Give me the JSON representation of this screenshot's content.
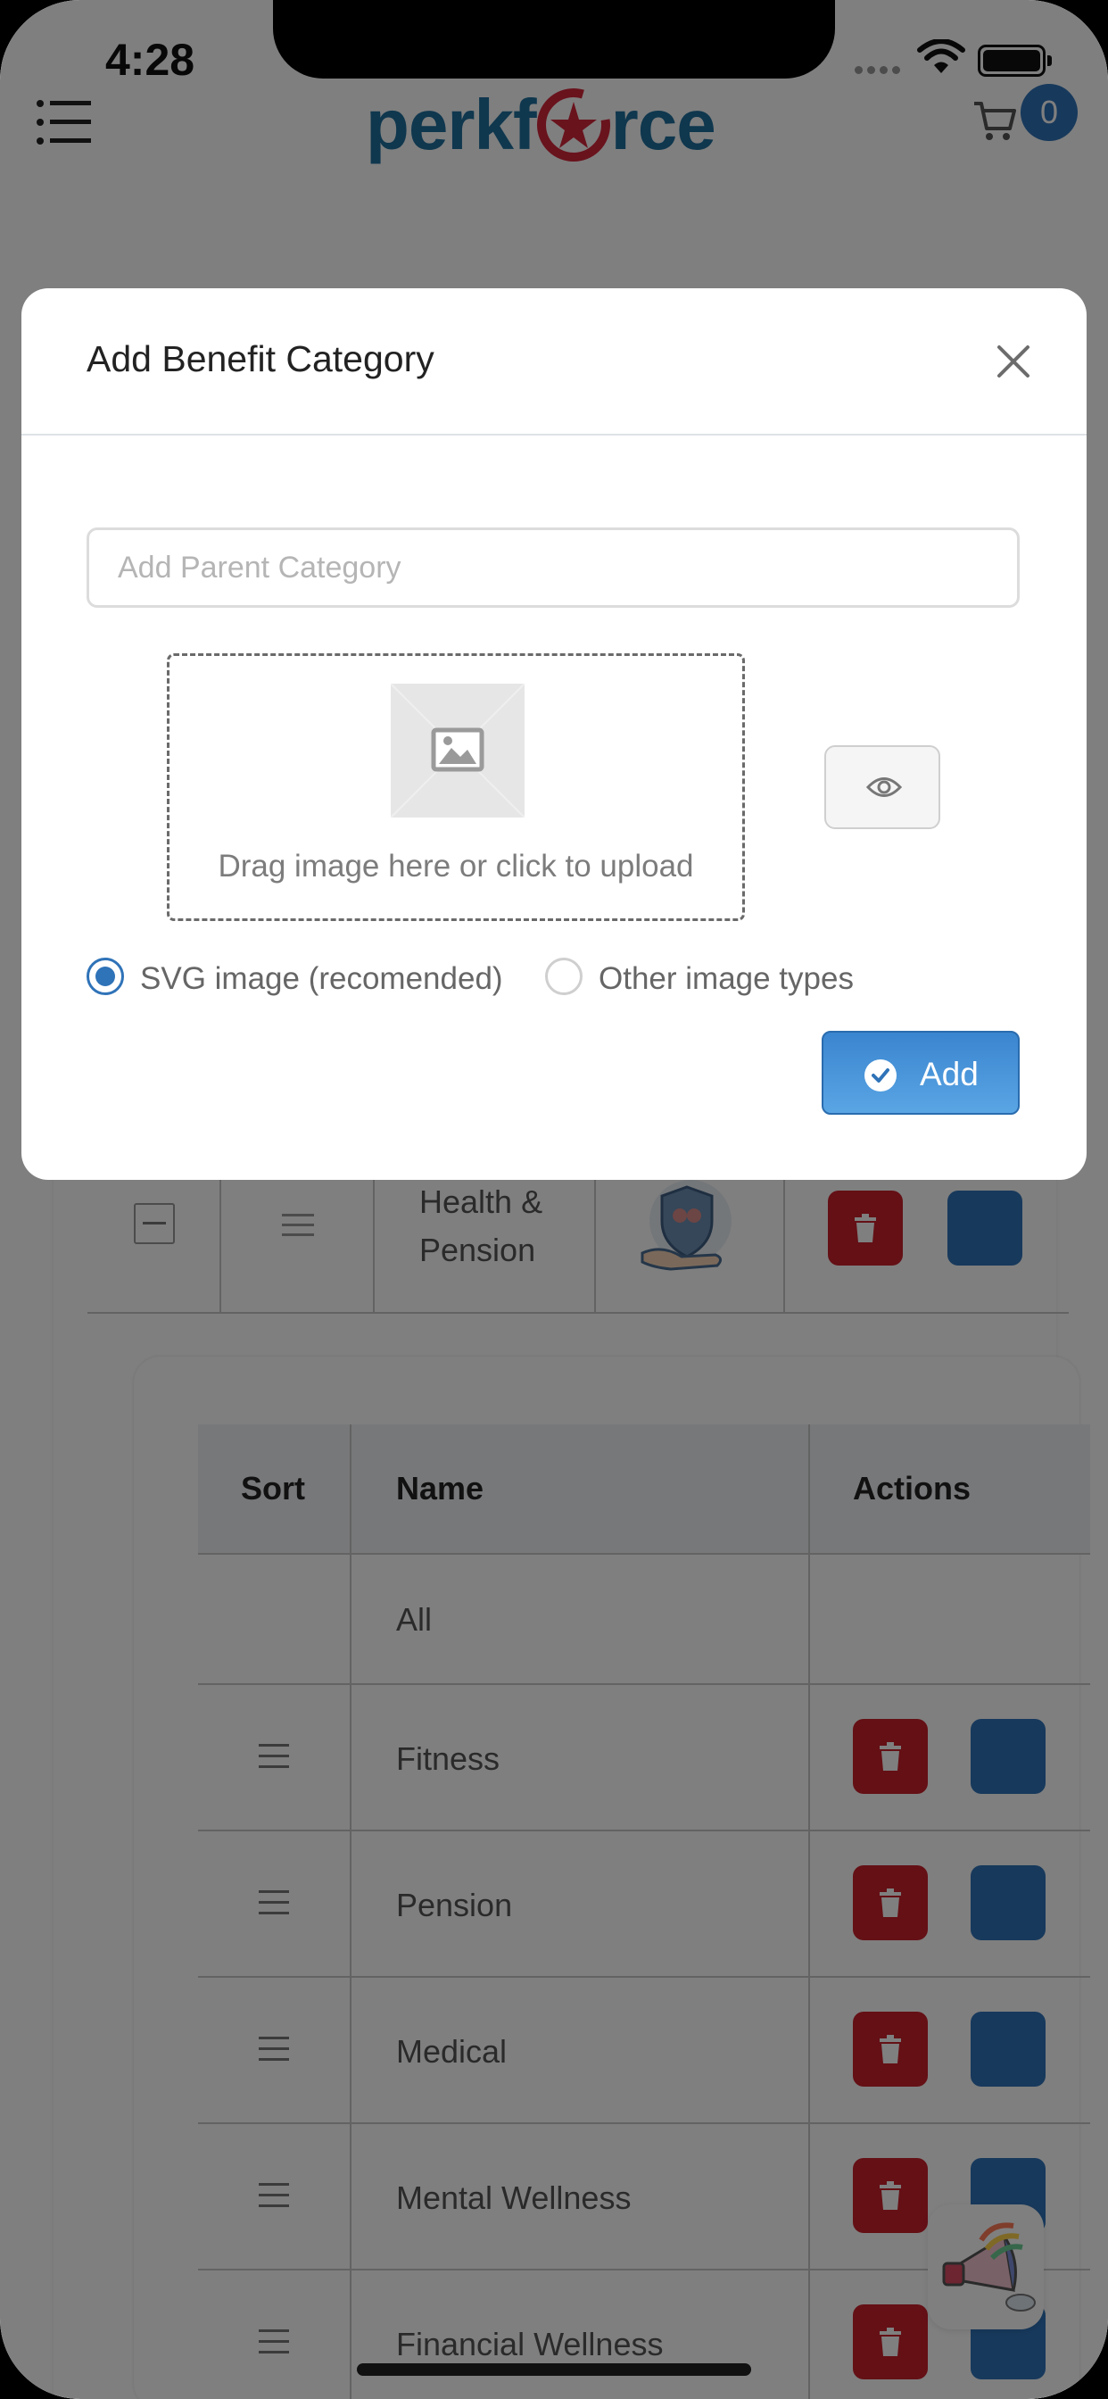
{
  "status_bar": {
    "time": "4:28"
  },
  "navbar": {
    "brand_left": "perkf",
    "brand_right": "rce",
    "cart_count": "0"
  },
  "background_table": {
    "top_row_name_line1": "Health &",
    "top_row_name_line2": "Pension",
    "headers": {
      "sort": "Sort",
      "name": "Name",
      "actions": "Actions"
    },
    "rows": [
      {
        "name": "All"
      },
      {
        "name": "Fitness"
      },
      {
        "name": "Pension"
      },
      {
        "name": "Medical"
      },
      {
        "name": "Mental Wellness"
      },
      {
        "name": "Financial Wellness"
      }
    ]
  },
  "modal": {
    "title": "Add Benefit Category",
    "parent_category_placeholder": "Add Parent Category",
    "parent_category_value": "",
    "dropzone_text": "Drag image here or click to upload",
    "radio_svg_label": "SVG image (recomended)",
    "radio_other_label": "Other image types",
    "selected_image_type": "svg",
    "add_label": "Add"
  },
  "colors": {
    "primary": "#2f73b8",
    "danger": "#c9202b",
    "backdrop": "rgba(0,0,0,0.5)"
  }
}
